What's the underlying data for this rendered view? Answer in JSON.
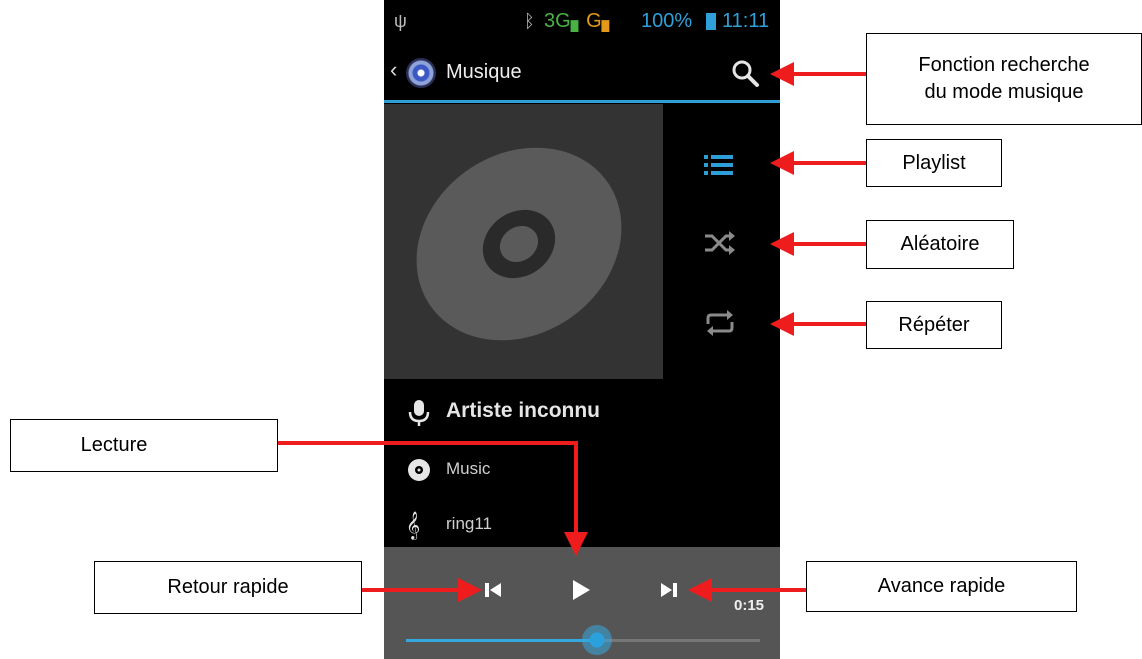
{
  "status_bar": {
    "network_3g": "3G",
    "network_g": "G",
    "battery": "100%",
    "time": "11:11"
  },
  "action_bar": {
    "title": "Musique",
    "icons": [
      "back-chevron-icon",
      "music-app-icon",
      "search-icon"
    ]
  },
  "side_controls": [
    "playlist-icon",
    "shuffle-icon",
    "repeat-icon"
  ],
  "track": {
    "artist": "Artiste inconnu",
    "album": "Music",
    "song": "ring11"
  },
  "playback": {
    "elapsed": "0:15",
    "progress_fraction": 0.54,
    "buttons": [
      "previous-icon",
      "play-icon",
      "next-icon"
    ]
  },
  "annotations": {
    "search_line1": "Fonction recherche",
    "search_line2": "du mode musique",
    "playlist": "Playlist",
    "shuffle": "Aléatoire",
    "repeat": "Répéter",
    "play": "Lecture",
    "rewind": "Retour rapide",
    "forward": "Avance rapide"
  },
  "colors": {
    "accent": "#2f9ed6",
    "arrow": "#ee1c1c",
    "controls_bg": "#555555",
    "album_bg": "#333333"
  }
}
